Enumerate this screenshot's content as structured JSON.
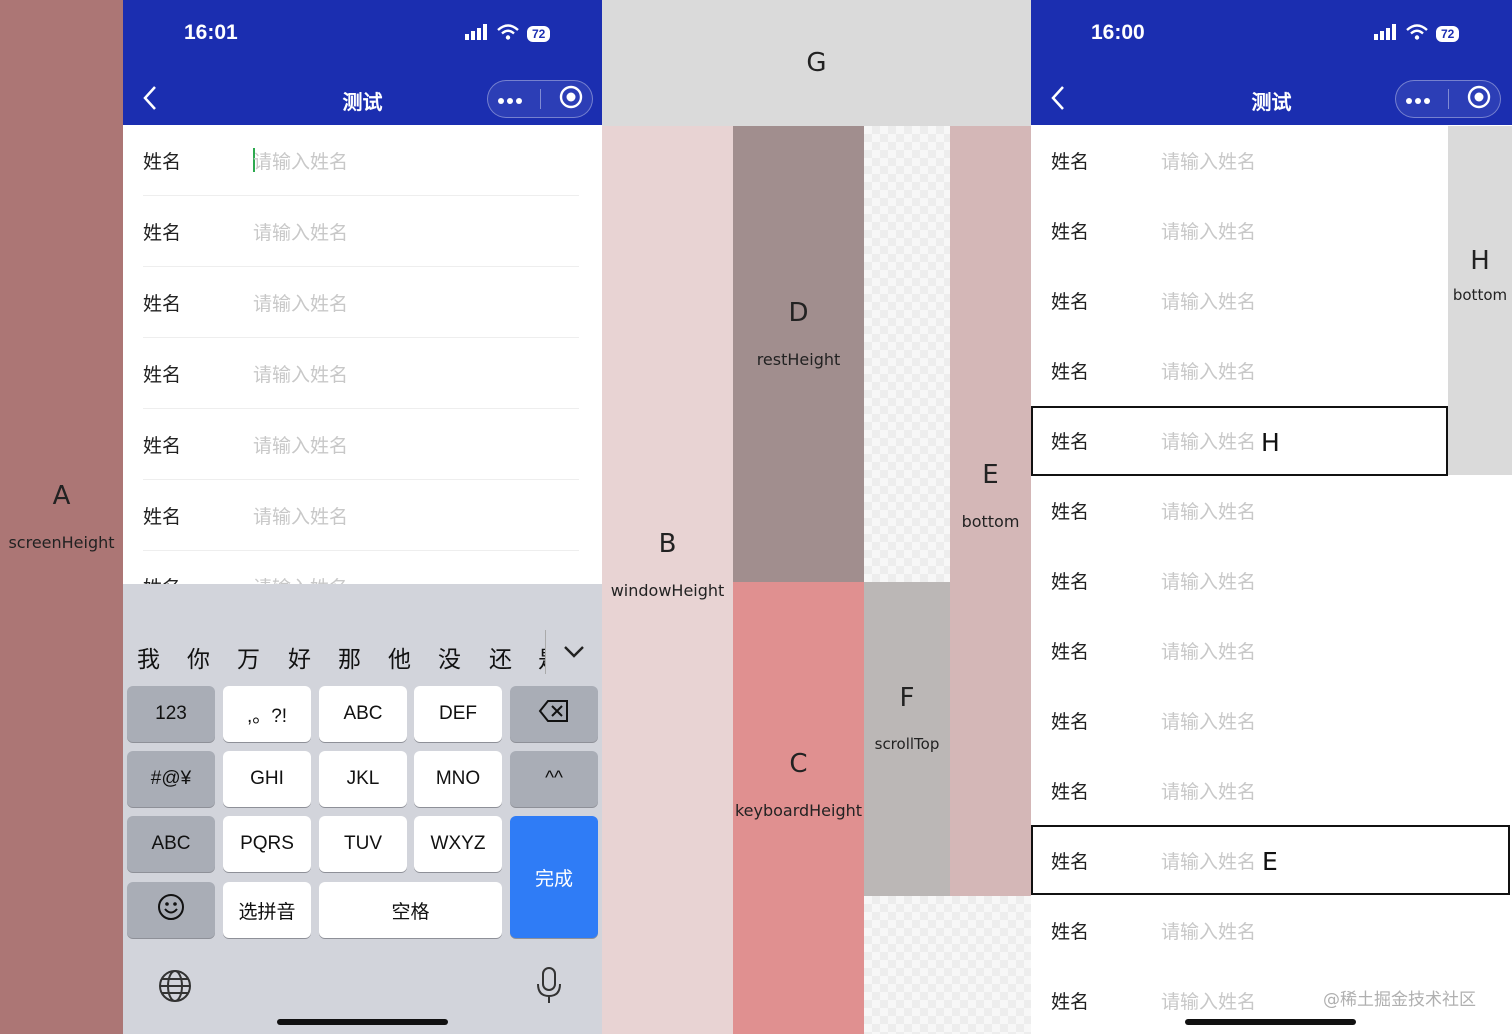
{
  "left_phone": {
    "status_time": "16:01",
    "battery": "72",
    "title": "测试",
    "rows": [
      {
        "label": "姓名",
        "placeholder": "请输入姓名"
      },
      {
        "label": "姓名",
        "placeholder": "请输入姓名"
      },
      {
        "label": "姓名",
        "placeholder": "请输入姓名"
      },
      {
        "label": "姓名",
        "placeholder": "请输入姓名"
      },
      {
        "label": "姓名",
        "placeholder": "请输入姓名"
      },
      {
        "label": "姓名",
        "placeholder": "请输入姓名"
      },
      {
        "label": "姓名",
        "placeholder": "请输入姓名"
      }
    ],
    "candidates": [
      "我",
      "你",
      "万",
      "好",
      "那",
      "他",
      "没",
      "还",
      "是"
    ],
    "keys": {
      "k123": "123",
      "punct": ",。?!",
      "abc": "ABC",
      "def": "DEF",
      "sym": "#@¥",
      "ghi": "GHI",
      "jkl": "JKL",
      "mno": "MNO",
      "face": "^^",
      "abc2": "ABC",
      "pqrs": "PQRS",
      "tuv": "TUV",
      "wxyz": "WXYZ",
      "done": "完成",
      "pinyin": "选拼音",
      "space": "空格"
    }
  },
  "diagram": {
    "A": {
      "letter": "A",
      "label": "screenHeight"
    },
    "G": {
      "letter": "G"
    },
    "B": {
      "letter": "B",
      "label": "windowHeight"
    },
    "D": {
      "letter": "D",
      "label": "restHeight"
    },
    "C": {
      "letter": "C",
      "label": "keyboardHeight"
    },
    "F": {
      "letter": "F",
      "label": "scrollTop"
    },
    "E": {
      "letter": "E",
      "label": "bottom"
    }
  },
  "right_phone": {
    "status_time": "16:00",
    "battery": "72",
    "title": "测试",
    "rows": [
      {
        "label": "姓名",
        "placeholder": "请输入姓名"
      },
      {
        "label": "姓名",
        "placeholder": "请输入姓名"
      },
      {
        "label": "姓名",
        "placeholder": "请输入姓名"
      },
      {
        "label": "姓名",
        "placeholder": "请输入姓名"
      },
      {
        "label": "姓名",
        "placeholder": "请输入姓名"
      },
      {
        "label": "姓名",
        "placeholder": "请输入姓名"
      },
      {
        "label": "姓名",
        "placeholder": "请输入姓名"
      },
      {
        "label": "姓名",
        "placeholder": "请输入姓名"
      },
      {
        "label": "姓名",
        "placeholder": "请输入姓名"
      },
      {
        "label": "姓名",
        "placeholder": "请输入姓名"
      },
      {
        "label": "姓名",
        "placeholder": "请输入姓名"
      },
      {
        "label": "姓名",
        "placeholder": "请输入姓名"
      },
      {
        "label": "姓名",
        "placeholder": "请输入姓名"
      }
    ],
    "marker_h": "H",
    "marker_e": "E",
    "h_panel": {
      "letter": "H",
      "label": "bottom"
    },
    "watermark": "@稀土掘金技术社区"
  },
  "colors": {
    "nav_blue": "#1b2eb0",
    "screen_height": "#ac7675",
    "window_height": "#e8d3d3",
    "rest_height": "#a18e8e",
    "keyboard_height": "#e09090",
    "scroll_top": "#bbb7b6",
    "bottom": "#d4b7b7",
    "g_area": "#dadada",
    "keyboard_bg": "#d2d4db",
    "done_blue": "#2f7cf6"
  },
  "icons": [
    "back-chevron-icon",
    "more-dots-icon",
    "target-icon",
    "signal-icon",
    "wifi-icon",
    "battery-icon",
    "backspace-icon",
    "emoji-icon",
    "globe-icon",
    "microphone-icon",
    "collapse-chevron-icon"
  ]
}
